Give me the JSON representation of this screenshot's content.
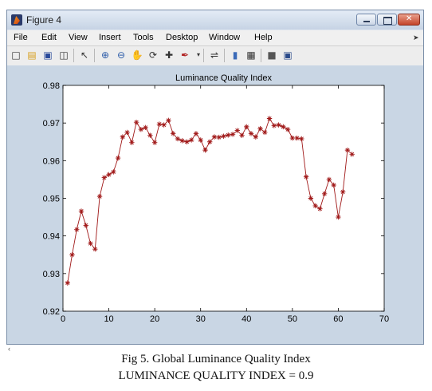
{
  "window": {
    "title": "Figure 4"
  },
  "menu": {
    "items": [
      "File",
      "Edit",
      "View",
      "Insert",
      "Tools",
      "Desktop",
      "Window",
      "Help"
    ]
  },
  "toolbar": {
    "icons": [
      "new-figure-icon",
      "open-file-icon",
      "save-icon",
      "print-icon",
      "pointer-icon",
      "zoom-in-icon",
      "zoom-out-icon",
      "pan-hand-icon",
      "rotate-3d-icon",
      "data-cursor-icon",
      "brush-icon",
      "link-plot-icon",
      "colorbar-icon",
      "legend-icon",
      "hide-plot-tools-icon",
      "show-plot-tools-icon"
    ]
  },
  "colors": {
    "figure_bg": "#c9d6e4",
    "axes_bg": "#ffffff",
    "line": "#a01818"
  },
  "chart_data": {
    "type": "line",
    "title": "Luminance Quality Index",
    "xlabel": "",
    "ylabel": "",
    "xlim": [
      0,
      70
    ],
    "ylim": [
      0.92,
      0.98
    ],
    "xticks": [
      "0",
      "10",
      "20",
      "30",
      "40",
      "50",
      "60",
      "70"
    ],
    "yticks": [
      "0.92",
      "0.93",
      "0.94",
      "0.95",
      "0.96",
      "0.97",
      "0.98"
    ],
    "marker": "*",
    "grid": false,
    "series": [
      {
        "x": [
          1,
          2,
          3,
          4,
          5,
          6,
          7,
          8,
          9,
          10,
          11,
          12,
          13,
          14,
          15,
          16,
          17,
          18,
          19,
          20,
          21,
          22,
          23,
          24,
          25,
          26,
          27,
          28,
          29,
          30,
          31,
          32,
          33,
          34,
          35,
          36,
          37,
          38,
          39,
          40,
          41,
          42,
          43,
          44,
          45,
          46,
          47,
          48,
          49,
          50,
          51,
          52,
          53,
          54,
          55,
          56,
          57,
          58,
          59,
          60,
          61,
          62,
          63
        ],
        "y": [
          0.9275,
          0.935,
          0.9417,
          0.9466,
          0.9428,
          0.938,
          0.9365,
          0.9505,
          0.9555,
          0.9563,
          0.957,
          0.9607,
          0.9663,
          0.9675,
          0.9648,
          0.9702,
          0.9683,
          0.9688,
          0.9667,
          0.9648,
          0.9697,
          0.9695,
          0.9707,
          0.9672,
          0.9658,
          0.9653,
          0.965,
          0.9655,
          0.9672,
          0.9655,
          0.9628,
          0.965,
          0.9663,
          0.9662,
          0.9665,
          0.9668,
          0.967,
          0.968,
          0.9667,
          0.969,
          0.9672,
          0.9663,
          0.9685,
          0.9675,
          0.9712,
          0.9693,
          0.9695,
          0.969,
          0.9683,
          0.966,
          0.966,
          0.9658,
          0.9557,
          0.95,
          0.948,
          0.9472,
          0.9512,
          0.955,
          0.9535,
          0.945,
          0.9517,
          0.9628,
          0.9617
        ]
      }
    ]
  },
  "caption": {
    "line1": "Fig  5. Global Luminance Quality Index",
    "line2": "LUMINANCE QUALITY INDEX = 0.9"
  }
}
